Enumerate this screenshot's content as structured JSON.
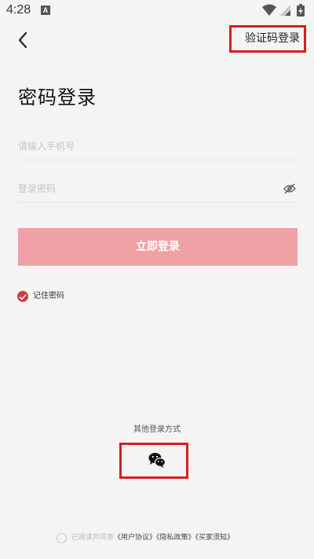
{
  "status_bar": {
    "time": "4:28",
    "notification_letter": "A",
    "icons": [
      "wifi-icon",
      "signal-icon",
      "battery-charging-icon"
    ]
  },
  "header": {
    "back_icon": "chevron-left-icon",
    "sms_login_label": "验证码登录"
  },
  "title": "密码登录",
  "form": {
    "phone_placeholder": "请输入手机号",
    "phone_value": "",
    "password_placeholder": "登录密码",
    "password_value": "",
    "eye_icon": "eye-closed-icon",
    "login_button": "立即登录",
    "remember_label": "记住密码",
    "remember_checked": true
  },
  "other_login": {
    "label": "其他登录方式",
    "wechat_icon": "wechat-icon"
  },
  "agreement": {
    "prefix": "已阅读并同意",
    "links": [
      "《用户协议》",
      "《隐私政策》",
      "《买家须知》"
    ]
  },
  "colors": {
    "login_button": "#f0a1a5",
    "check": "#d33b3f",
    "highlight_border": "#d81e1e",
    "background": "#f4f4f4"
  }
}
